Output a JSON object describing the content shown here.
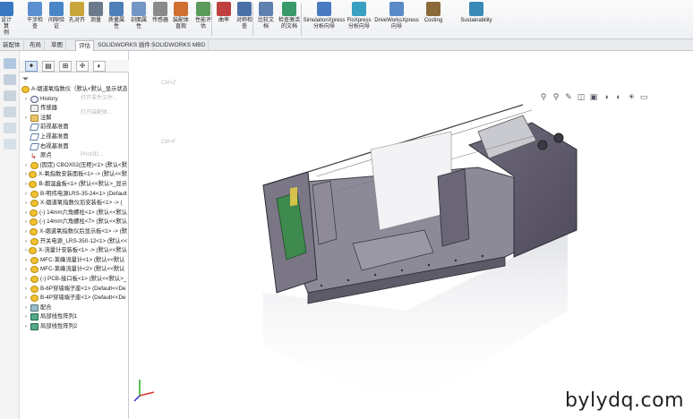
{
  "ribbon": {
    "items": [
      {
        "label": "设计算\n例",
        "icon": "design-study-icon",
        "color": "#3a78c2"
      },
      {
        "label": "干涉检\n查",
        "icon": "interference-check-icon",
        "color": "#5b8fd0"
      },
      {
        "label": "间隙验\n证",
        "icon": "clearance-icon",
        "color": "#4a86c8"
      },
      {
        "label": "孔对齐",
        "icon": "hole-align-icon",
        "color": "#c9a63a"
      },
      {
        "label": "测量",
        "icon": "measure-icon",
        "color": "#6a7a8c"
      },
      {
        "label": "质量属\n性",
        "icon": "mass-properties-icon",
        "color": "#4f7fb8"
      },
      {
        "label": "剖面属\n性",
        "icon": "section-properties-icon",
        "color": "#7396c4"
      },
      {
        "label": "传感器",
        "icon": "sensor-icon",
        "color": "#8a8a8a"
      },
      {
        "label": "装配体\n直观",
        "icon": "assembly-visualization-icon",
        "color": "#d07030"
      },
      {
        "label": "性能评\n估",
        "icon": "performance-icon",
        "color": "#5a9a5a"
      },
      {
        "label": "曲率",
        "icon": "curvature-icon",
        "color": "#c04040"
      },
      {
        "label": "对称检\n查",
        "icon": "symmetry-check-icon",
        "color": "#4a70a8"
      },
      {
        "label": "比较文\n档",
        "icon": "compare-icon",
        "color": "#6080b0"
      },
      {
        "label": "检查激活\n的文档",
        "icon": "check-doc-icon",
        "color": "#3a9a6a"
      },
      {
        "label": "SimulationXpress\n分析向导",
        "icon": "simulation-icon",
        "color": "#4a7ac0"
      },
      {
        "label": "FloXpress\n分析向导",
        "icon": "floxpress-icon",
        "color": "#3aa0c0"
      },
      {
        "label": "DriveWorksXpress\n向导",
        "icon": "driveworks-icon",
        "color": "#5a8ac8"
      },
      {
        "label": "Costing",
        "icon": "costing-icon",
        "color": "#8a6a3a"
      },
      {
        "label": "Sustainability",
        "icon": "sustainability-icon",
        "color": "#3a8ab8"
      }
    ]
  },
  "tabs": [
    "装配体",
    "布局",
    "草图",
    "评估",
    "SOLIDWORKS 插件",
    "SOLIDWORKS MBD"
  ],
  "tabs_active": 3,
  "panel": {
    "tabs": [
      "✦",
      "▤",
      "⊞",
      "✛",
      "◐"
    ],
    "tree": [
      {
        "label": "A-烟道氧指数仪（默认<默认_显示状态-1>",
        "icon": "part",
        "exp": ""
      },
      {
        "label": "History",
        "icon": "hist",
        "exp": "›"
      },
      {
        "label": "传感器",
        "icon": "sensor",
        "exp": ""
      },
      {
        "label": "注解",
        "icon": "folder",
        "exp": "›"
      },
      {
        "label": "前视基准面",
        "icon": "plane",
        "exp": ""
      },
      {
        "label": "上视基准面",
        "icon": "plane",
        "exp": ""
      },
      {
        "label": "右视基准面",
        "icon": "plane",
        "exp": ""
      },
      {
        "label": "原点",
        "icon": "origin",
        "exp": ""
      },
      {
        "label": "(固定) CBOX02(压柜)<1> (默认<默",
        "icon": "part",
        "exp": "›"
      },
      {
        "label": "X-氧指数安装面板<1> -> (默认<<默",
        "icon": "part",
        "exp": "›"
      },
      {
        "label": "B-烟温盒板<1> (默认<<默认>_显示",
        "icon": "part",
        "exp": "›"
      },
      {
        "label": "B-明纬电源LRS-35-24<1> (Default",
        "icon": "part",
        "exp": "›"
      },
      {
        "label": "X-烟道氧指数仪后安装板<1> -> (",
        "icon": "part",
        "exp": "›"
      },
      {
        "label": "(-) 14mm六角螺柱<1> (默认<<默认",
        "icon": "part",
        "exp": "›"
      },
      {
        "label": "(-) 14mm六角螺柱<7> (默认<<默认",
        "icon": "part",
        "exp": "›"
      },
      {
        "label": "X-烟道氧指数仪后显示板<1> -> (默",
        "icon": "part",
        "exp": "›"
      },
      {
        "label": "开关电源_LRS-350-12<1> (默认<<",
        "icon": "part",
        "exp": "›"
      },
      {
        "label": "X-流量计安装板<1> -> (默认<<默认",
        "icon": "part",
        "exp": "›"
      },
      {
        "label": "MFC-莱峰流量计<1> (默认<<默认",
        "icon": "part",
        "exp": "›"
      },
      {
        "label": "MFC-莱峰流量计<2> (默认<<默认",
        "icon": "part",
        "exp": "›"
      },
      {
        "label": "(-) PCB-接口板<1> (默认<<默认>_",
        "icon": "part",
        "exp": "›"
      },
      {
        "label": "B-6P穿墙端子座<1> (Default<<De",
        "icon": "part",
        "exp": "›"
      },
      {
        "label": "B-4P穿墙端子座<1> (Default<<De",
        "icon": "part",
        "exp": "›"
      },
      {
        "label": "配合",
        "icon": "mate",
        "exp": "›"
      },
      {
        "label": "局部线性阵列1",
        "icon": "pat",
        "exp": "›"
      },
      {
        "label": "局部线性阵列2",
        "icon": "pat",
        "exp": "›"
      }
    ]
  },
  "ghost_menu": [
    "Ctrl+Z",
    "Ctrl+F",
    "打开零件文件...",
    "打开装配体...",
    "Print3D..."
  ],
  "viewport": {
    "hud": [
      "⚲",
      "⚲",
      "✎",
      "◫",
      "▣",
      "◑",
      "◐",
      "☀",
      "▭"
    ],
    "watermark": "bylydq.com"
  }
}
